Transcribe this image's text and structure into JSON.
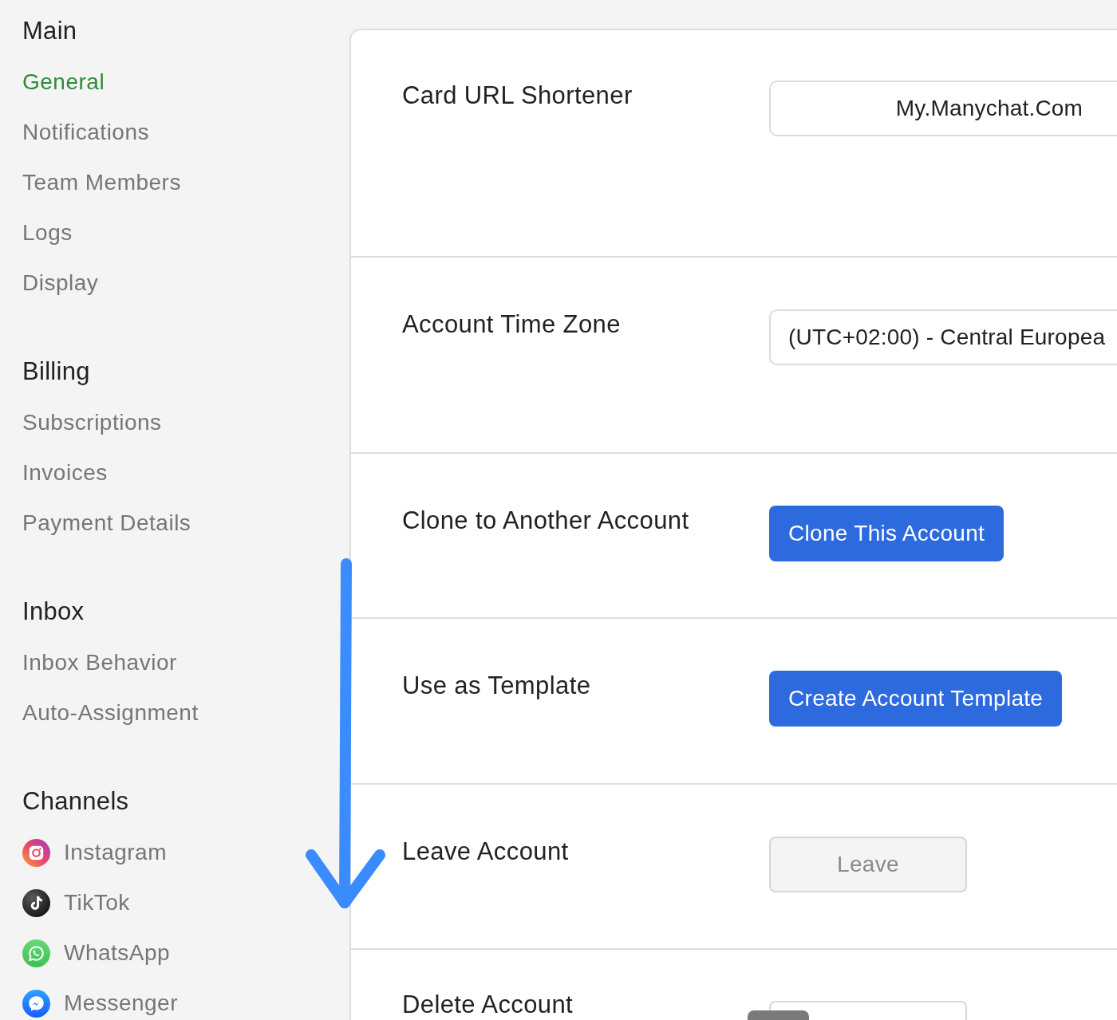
{
  "sidebar": {
    "sections": [
      {
        "heading": "Main",
        "items": [
          {
            "label": "General",
            "selected": true
          },
          {
            "label": "Notifications",
            "selected": false
          },
          {
            "label": "Team Members",
            "selected": false
          },
          {
            "label": "Logs",
            "selected": false
          },
          {
            "label": "Display",
            "selected": false
          }
        ]
      },
      {
        "heading": "Billing",
        "items": [
          {
            "label": "Subscriptions",
            "selected": false
          },
          {
            "label": "Invoices",
            "selected": false
          },
          {
            "label": "Payment Details",
            "selected": false
          }
        ]
      },
      {
        "heading": "Inbox",
        "items": [
          {
            "label": "Inbox Behavior",
            "selected": false
          },
          {
            "label": "Auto-Assignment",
            "selected": false
          }
        ]
      },
      {
        "heading": "Channels",
        "items": [
          {
            "label": "Instagram",
            "kind": "instagram",
            "selected": false
          },
          {
            "label": "TikTok",
            "kind": "tiktok",
            "selected": false
          },
          {
            "label": "WhatsApp",
            "kind": "whatsapp",
            "selected": false
          },
          {
            "label": "Messenger",
            "kind": "messenger",
            "selected": false
          }
        ]
      }
    ]
  },
  "settings": {
    "rows": [
      {
        "label": "Card URL Shortener",
        "control": {
          "kind": "input",
          "value": "My.Manychat.Com"
        }
      },
      {
        "label": "Account Time Zone",
        "control": {
          "kind": "select",
          "value": "(UTC+02:00) - Central Europea"
        }
      },
      {
        "label": "Clone to Another Account",
        "control": {
          "kind": "primary_button",
          "label": "Clone This Account",
          "disabled": false
        }
      },
      {
        "label": "Use as Template",
        "control": {
          "kind": "primary_button",
          "label": "Create Account Template",
          "disabled": false
        }
      },
      {
        "label": "Leave Account",
        "control": {
          "kind": "secondary_button",
          "label": "Leave",
          "disabled": true
        }
      },
      {
        "label": "Delete Account",
        "control": {
          "kind": "secondary_button",
          "disabled": false,
          "overlay": true
        }
      }
    ]
  }
}
